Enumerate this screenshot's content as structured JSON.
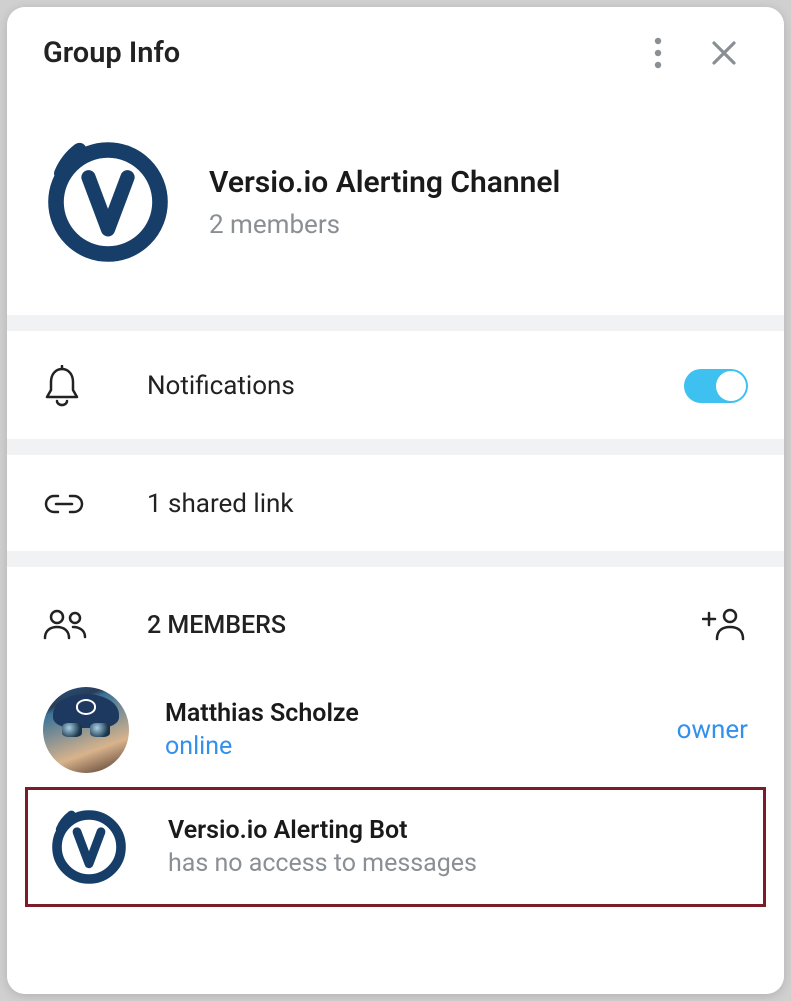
{
  "header": {
    "title": "Group Info"
  },
  "group": {
    "name": "Versio.io Alerting Channel",
    "subtitle": "2 members"
  },
  "notifications": {
    "label": "Notifications"
  },
  "shared": {
    "label": "1 shared link"
  },
  "members_section": {
    "title": "2 MEMBERS"
  },
  "members": [
    {
      "name": "Matthias Scholze",
      "status": "online",
      "role": "owner"
    },
    {
      "name": "Versio.io Alerting Bot",
      "status": "has no access to messages",
      "role": ""
    }
  ]
}
